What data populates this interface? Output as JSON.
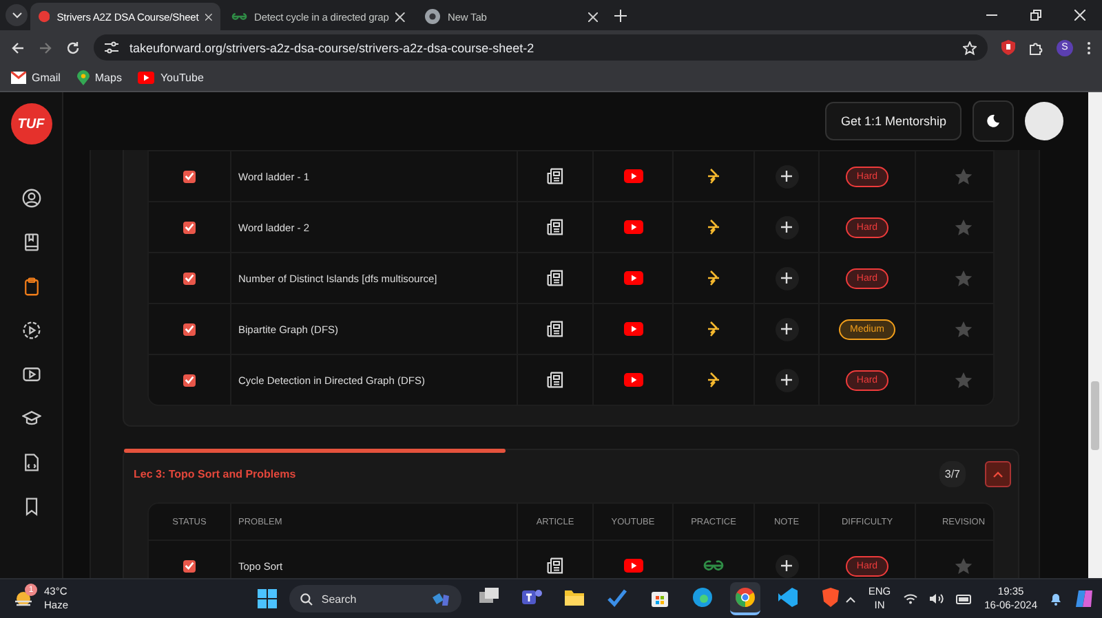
{
  "browser": {
    "tabs": [
      {
        "title": "Strivers A2Z DSA Course/Sheet",
        "selected": true
      },
      {
        "title": "Detect cycle in a directed grap",
        "selected": false
      },
      {
        "title": "New Tab",
        "selected": false
      }
    ],
    "url": "takeuforward.org/strivers-a2z-dsa-course/strivers-a2z-dsa-course-sheet-2",
    "profile": "S",
    "bookmarks": [
      {
        "label": "Gmail",
        "kind": "mail"
      },
      {
        "label": "Maps",
        "kind": "pin"
      },
      {
        "label": "YouTube",
        "kind": "play"
      }
    ]
  },
  "logo": "TUF",
  "sidebar": {
    "items": [
      {
        "selected": false
      },
      {
        "selected": false
      },
      {
        "selected": true
      },
      {
        "selected": false
      },
      {
        "selected": false
      },
      {
        "selected": false
      },
      {
        "selected": false
      },
      {
        "selected": false
      }
    ]
  },
  "header": {
    "mentorship_button": "Get 1:1 Mentorship"
  },
  "sections": [
    {
      "rows": [
        {
          "problem": "Word ladder - 1",
          "checked": true,
          "kind": "arrow",
          "difficulty": "Hard",
          "color": "#ef3b3b"
        },
        {
          "problem": "Word ladder - 2",
          "checked": true,
          "kind": "arrow",
          "difficulty": "Hard",
          "color": "#ef3b3b"
        },
        {
          "problem": "Number of Distinct Islands [dfs multisource]",
          "checked": true,
          "kind": "arrow",
          "difficulty": "Hard",
          "color": "#ef3b3b"
        },
        {
          "problem": "Bipartite Graph (DFS)",
          "checked": true,
          "kind": "arrow",
          "difficulty": "Medium",
          "color": "#f29f1b"
        },
        {
          "problem": "Cycle Detection in Directed Graph (DFS)",
          "checked": true,
          "kind": "arrow",
          "difficulty": "Hard",
          "color": "#ef3b3b"
        }
      ]
    },
    {
      "title": "Lec 3: Topo Sort and Problems",
      "count": "3/7",
      "expanded": true,
      "columns": [
        "STATUS",
        "PROBLEM",
        "ARTICLE",
        "YOUTUBE",
        "PRACTICE",
        "NOTE",
        "DIFFICULTY",
        "REVISION"
      ],
      "rows": [
        {
          "problem": "Topo Sort",
          "checked": true,
          "kind": "glasses",
          "difficulty": "Hard",
          "color": "#ef3b3b"
        }
      ]
    }
  ],
  "taskbar": {
    "weather": {
      "temperature": "43°C",
      "condition": "Haze",
      "badge": "1"
    },
    "search_placeholder": "Search",
    "apps": [
      {
        "active": false
      },
      {
        "active": false
      },
      {
        "active": false
      },
      {
        "active": false
      },
      {
        "active": false
      },
      {
        "active": false
      },
      {
        "active": true
      },
      {
        "active": false
      },
      {
        "active": false
      }
    ],
    "language": "ENG",
    "region": "IN",
    "time": "19:35",
    "date": "16-06-2024"
  }
}
